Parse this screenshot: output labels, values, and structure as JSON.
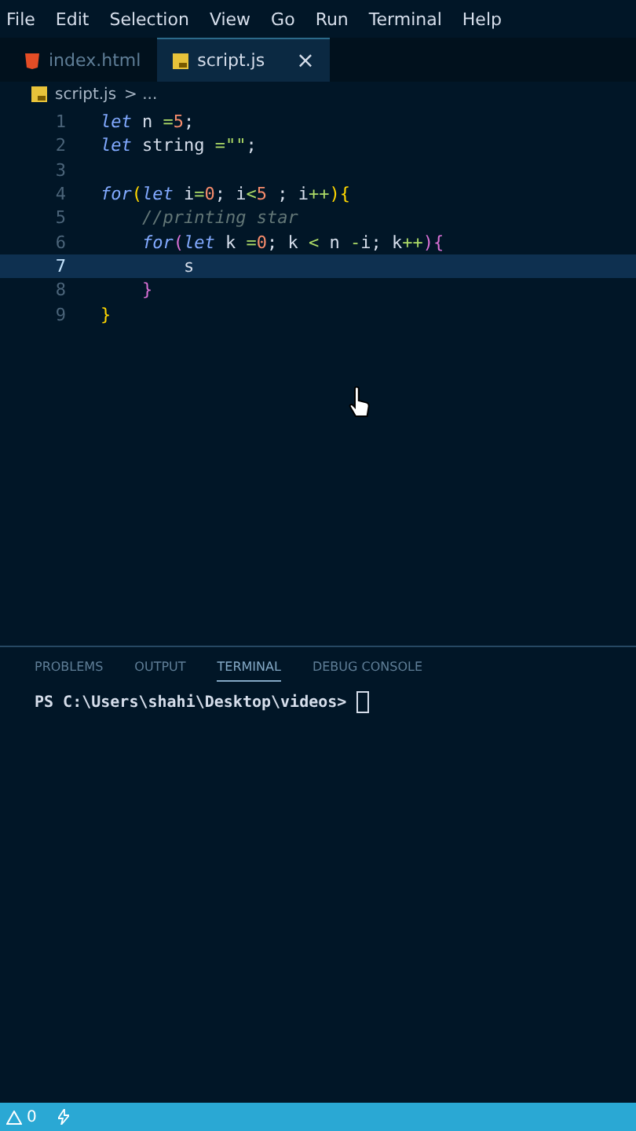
{
  "menu": [
    "File",
    "Edit",
    "Selection",
    "View",
    "Go",
    "Run",
    "Terminal",
    "Help"
  ],
  "tabs": [
    {
      "label": "index.html",
      "kind": "html",
      "selected": false
    },
    {
      "label": "script.js",
      "kind": "js",
      "selected": true,
      "close": "×"
    }
  ],
  "breadcrumb": {
    "file": "script.js",
    "rest": "> ..."
  },
  "code": [
    {
      "number": "1",
      "selected": false,
      "tokens": [
        {
          "t": "let",
          "kind": "keyword"
        },
        {
          "t": " n ",
          "kind": "identifier"
        },
        {
          "t": "=",
          "kind": "operator"
        },
        {
          "t": "5",
          "kind": "number"
        },
        {
          "t": ";",
          "kind": "identifier"
        }
      ]
    },
    {
      "number": "2",
      "selected": false,
      "tokens": [
        {
          "t": "let",
          "kind": "keyword"
        },
        {
          "t": " string ",
          "kind": "identifier"
        },
        {
          "t": "=\"\"",
          "kind": "operator"
        },
        {
          "t": ";",
          "kind": "identifier"
        }
      ]
    },
    {
      "number": "3",
      "selected": false
    },
    {
      "number": "4",
      "selected": false,
      "tokens": [
        {
          "t": "for",
          "kind": "keyword"
        },
        {
          "t": "(",
          "kind": "bracket"
        },
        {
          "t": "let",
          "kind": "keyword"
        },
        {
          "t": " i",
          "kind": "identifier"
        },
        {
          "t": "=",
          "kind": "operator"
        },
        {
          "t": "0",
          "kind": "number"
        },
        {
          "t": "; i",
          "kind": "identifier"
        },
        {
          "t": "<",
          "kind": "operator"
        },
        {
          "t": "5",
          "kind": "number"
        },
        {
          "t": " ; i",
          "kind": "identifier"
        },
        {
          "t": "++",
          "kind": "operator"
        },
        {
          "t": "){",
          "kind": "bracket"
        }
      ]
    },
    {
      "number": "5",
      "selected": false,
      "tokens": [
        {
          "t": "    //printing star",
          "kind": "comment"
        }
      ]
    },
    {
      "number": "6",
      "selected": false,
      "tokens": [
        {
          "t": "    for",
          "kind": "keyword"
        },
        {
          "t": "(",
          "kind": "bracket2"
        },
        {
          "t": "let",
          "kind": "keyword"
        },
        {
          "t": " k ",
          "kind": "identifier"
        },
        {
          "t": "=",
          "kind": "operator"
        },
        {
          "t": "0",
          "kind": "number"
        },
        {
          "t": "; k ",
          "kind": "identifier"
        },
        {
          "t": "<",
          "kind": "operator"
        },
        {
          "t": " n ",
          "kind": "identifier"
        },
        {
          "t": "-",
          "kind": "operator"
        },
        {
          "t": "i; k",
          "kind": "identifier"
        },
        {
          "t": "++",
          "kind": "operator"
        },
        {
          "t": "){",
          "kind": "bracket2"
        }
      ]
    },
    {
      "number": "7",
      "selected": true,
      "tokens": [
        {
          "t": "        s",
          "kind": "identifier"
        }
      ]
    },
    {
      "number": "8",
      "selected": false,
      "tokens": [
        {
          "t": "    }",
          "kind": "bracket2"
        }
      ]
    },
    {
      "number": "9",
      "selected": false,
      "tokens": [
        {
          "t": "}",
          "kind": "bracket"
        }
      ]
    }
  ],
  "panel_tabs": [
    {
      "label": "PROBLEMS",
      "selected": false
    },
    {
      "label": "OUTPUT",
      "selected": false
    },
    {
      "label": "TERMINAL",
      "selected": true
    },
    {
      "label": "DEBUG CONSOLE",
      "selected": false
    }
  ],
  "terminal": {
    "prompt": "PS C:\\Users\\shahi\\Desktop\\videos>"
  },
  "status": {
    "warnings": "0"
  }
}
